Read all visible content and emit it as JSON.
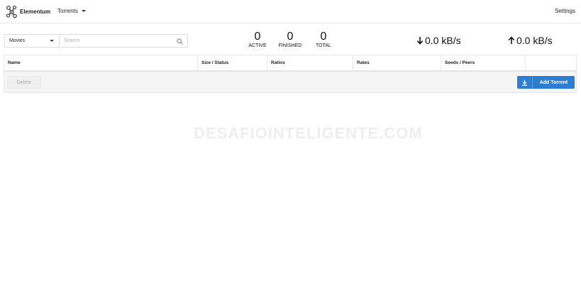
{
  "app": {
    "brand": "Elementum"
  },
  "nav": {
    "torrents_menu": "Torrents",
    "settings": "Settings"
  },
  "filters": {
    "category_selected": "Movies",
    "search_placeholder": "Search",
    "search_value": ""
  },
  "stats": {
    "active": {
      "value": "0",
      "label": "ACTIVE"
    },
    "finished": {
      "value": "0",
      "label": "FINISHED"
    },
    "total": {
      "value": "0",
      "label": "TOTAL"
    }
  },
  "speeds": {
    "download": "0.0 kB/s",
    "upload": "0.0 kB/s"
  },
  "table": {
    "columns": [
      "Name",
      "Size / Status",
      "Ratios",
      "Rates",
      "Seeds / Peers",
      ""
    ],
    "rows": []
  },
  "actions": {
    "delete_label": "Delete",
    "add_label": "Add Torrent"
  },
  "watermark": "DESAFIOINTELIGENTE.COM",
  "colors": {
    "primary": "#2d7ed3",
    "border": "#e6e6e6",
    "row_background": "#f5f5f5"
  },
  "icons": {
    "brand": "elementum-logo-icon",
    "search": "search-icon",
    "download": "arrow-down-icon",
    "upload": "arrow-up-icon",
    "add": "download-icon"
  }
}
